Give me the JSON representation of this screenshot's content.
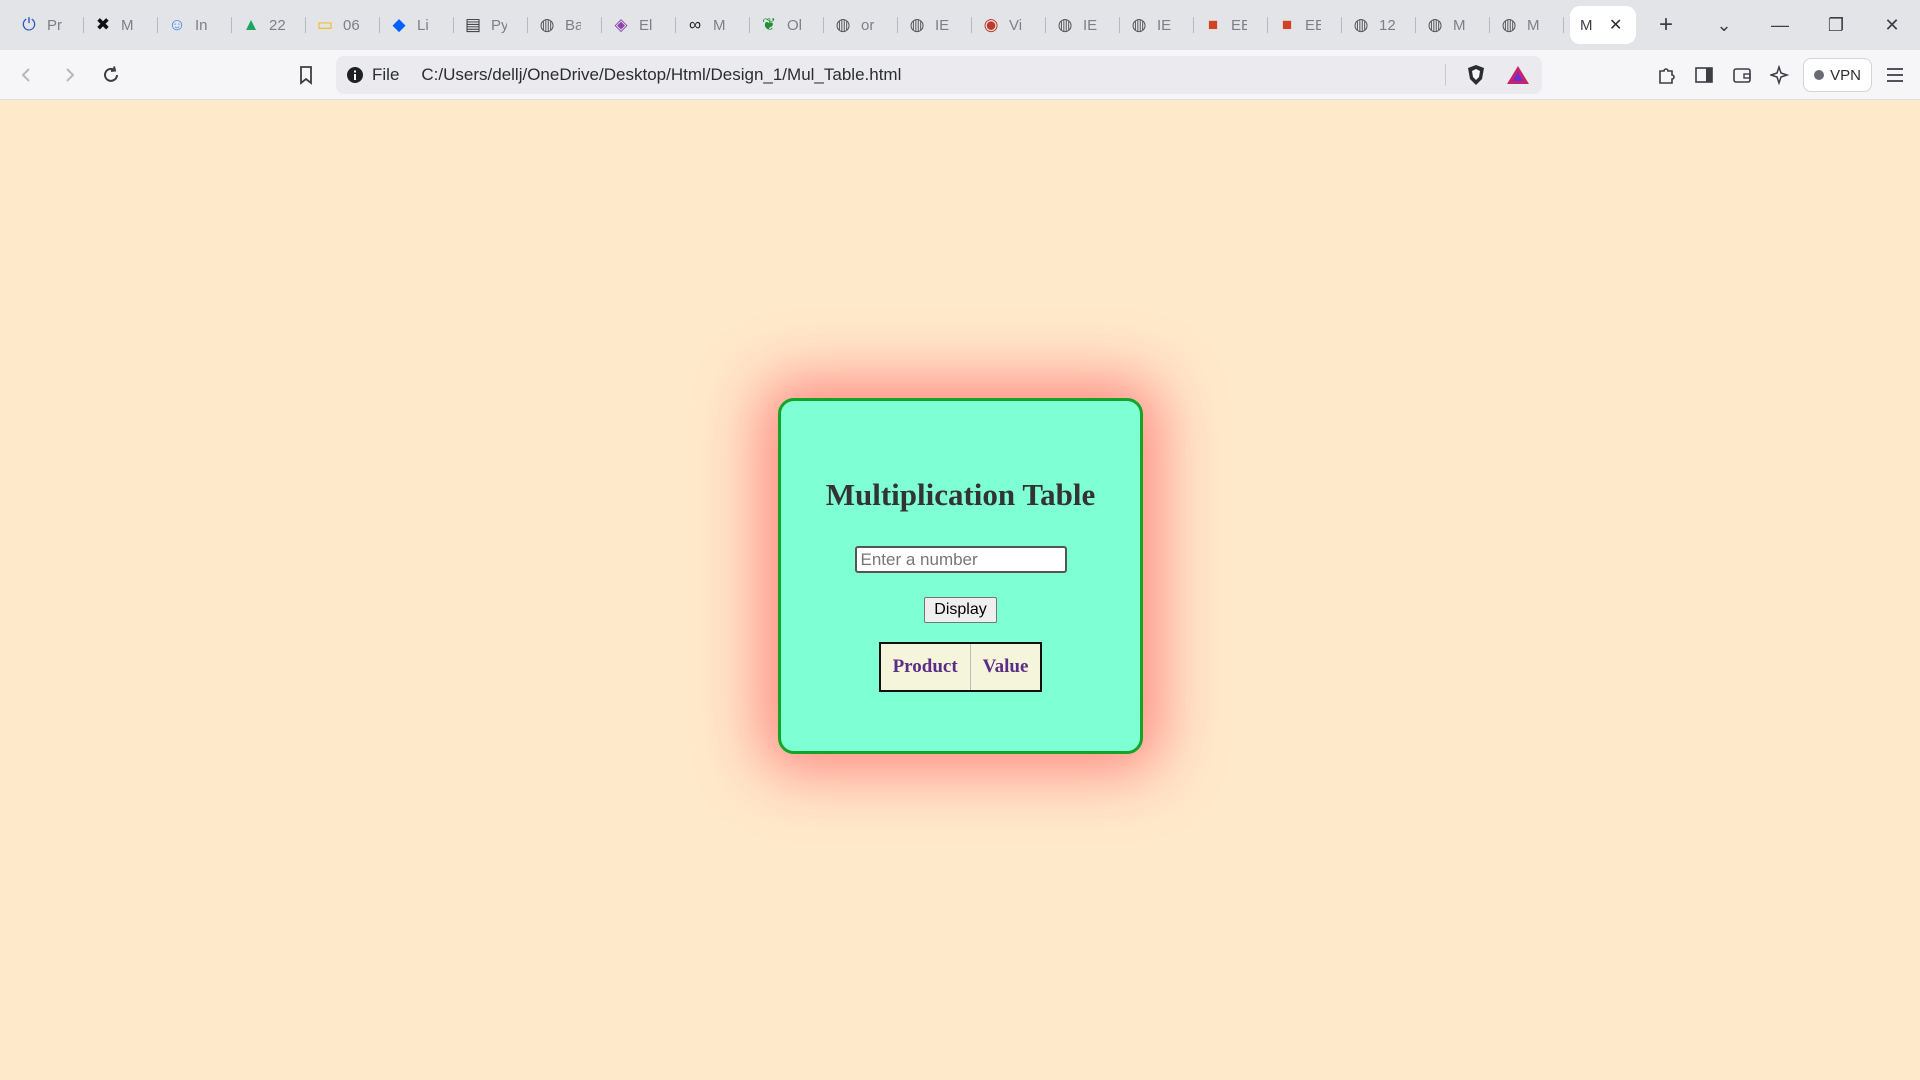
{
  "browser": {
    "tabs": [
      {
        "icon": "power-icon",
        "label": "Pr",
        "color": "#2b55c8"
      },
      {
        "icon": "x-logo-icon",
        "label": "M",
        "color": "#111111"
      },
      {
        "icon": "face-icon",
        "label": "In",
        "color": "#3b82f6"
      },
      {
        "icon": "drive-icon",
        "label": "22",
        "color": "#1fa463"
      },
      {
        "icon": "slides-icon",
        "label": "06",
        "color": "#f4b400"
      },
      {
        "icon": "dropbox-icon",
        "label": "Li",
        "color": "#0061fe"
      },
      {
        "icon": "book-icon",
        "label": "Py",
        "color": "#333333"
      },
      {
        "icon": "globe-icon",
        "label": "Ba",
        "color": "#555555"
      },
      {
        "icon": "layers-icon",
        "label": "El",
        "color": "#8e44ad"
      },
      {
        "icon": "binoculars-icon",
        "label": "M",
        "color": "#222222"
      },
      {
        "icon": "leaf-icon",
        "label": "Ol",
        "color": "#1f8f3a"
      },
      {
        "icon": "globe-icon",
        "label": "or",
        "color": "#555555"
      },
      {
        "icon": "globe-icon",
        "label": "IE",
        "color": "#555555"
      },
      {
        "icon": "target-icon",
        "label": "Vi",
        "color": "#c0392b"
      },
      {
        "icon": "globe-icon",
        "label": "IE",
        "color": "#555555"
      },
      {
        "icon": "globe-icon",
        "label": "IE",
        "color": "#555555"
      },
      {
        "icon": "powerpoint-icon",
        "label": "EE",
        "color": "#d04423"
      },
      {
        "icon": "powerpoint-icon",
        "label": "EE",
        "color": "#d04423"
      },
      {
        "icon": "globe-icon",
        "label": "12",
        "color": "#555555"
      },
      {
        "icon": "globe-icon",
        "label": "M",
        "color": "#555555"
      },
      {
        "icon": "globe-icon",
        "label": "M",
        "color": "#555555"
      }
    ],
    "active_tab": {
      "label": "M",
      "close": "✕"
    },
    "new_tab": "+",
    "window": {
      "tab_search": "⌄",
      "minimize": "—",
      "restore": "❐",
      "close": "✕"
    },
    "site_info_label": "File",
    "url": "C:/Users/dellj/OneDrive/Desktop/Html/Design_1/Mul_Table.html",
    "vpn_label": "VPN"
  },
  "page": {
    "title": "Multiplication Table",
    "input": {
      "placeholder": "Enter a number",
      "value": ""
    },
    "button_label": "Display",
    "table_headers": [
      "Product",
      "Value"
    ]
  }
}
